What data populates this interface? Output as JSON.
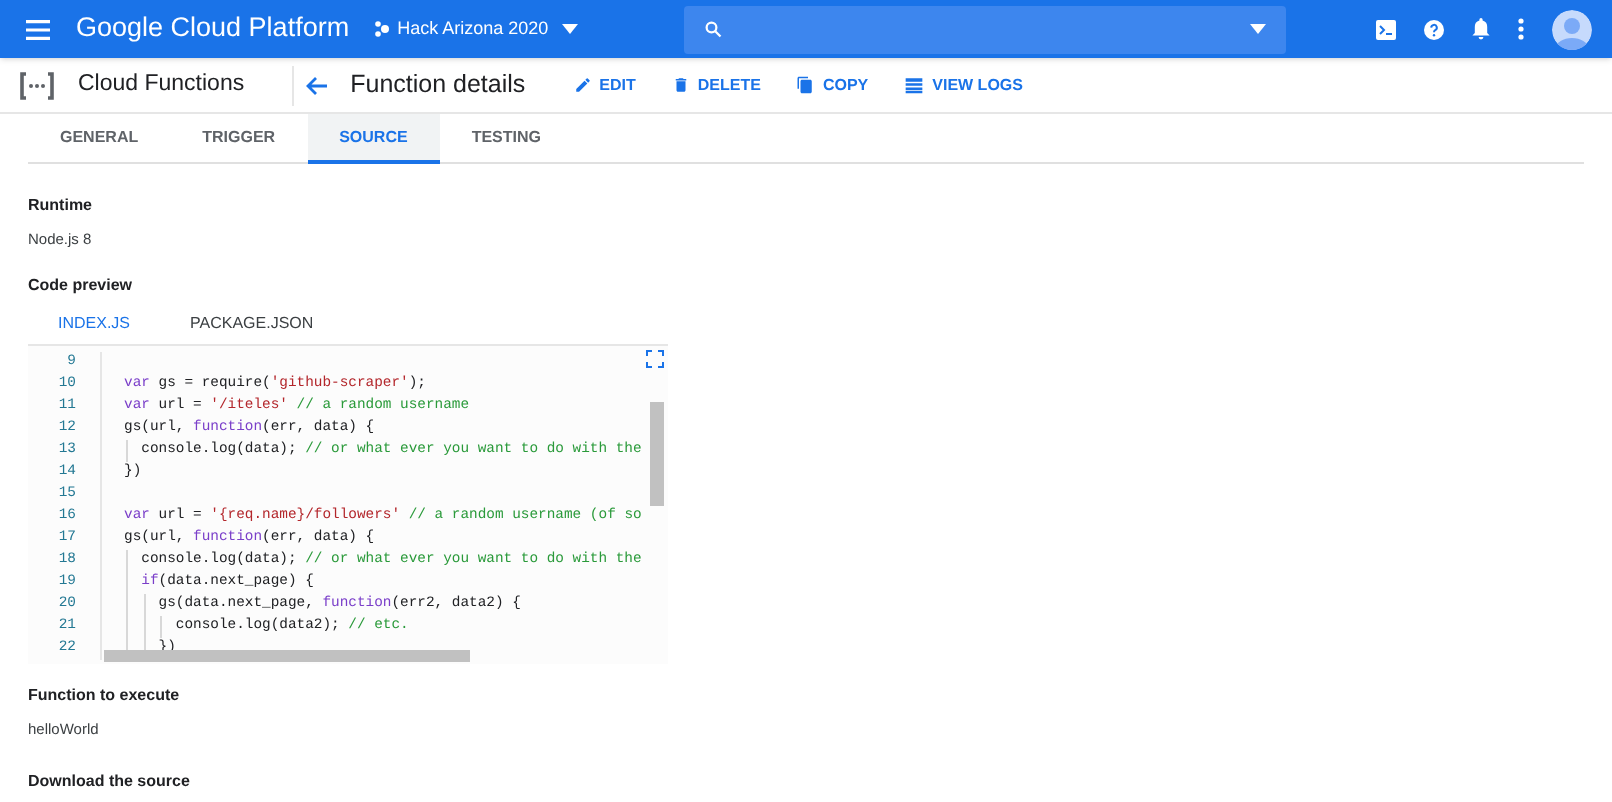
{
  "app_bar": {
    "title": "Google Cloud Platform",
    "project": "Hack Arizona 2020"
  },
  "header": {
    "product": "Cloud Functions",
    "page_title": "Function details",
    "actions": [
      {
        "kind": "edit",
        "label": "EDIT"
      },
      {
        "kind": "delete",
        "label": "DELETE"
      },
      {
        "kind": "copy",
        "label": "COPY"
      },
      {
        "kind": "logs",
        "label": "VIEW LOGS"
      }
    ]
  },
  "tabs": [
    {
      "label": "GENERAL",
      "selected": false
    },
    {
      "label": "TRIGGER",
      "selected": false
    },
    {
      "label": "SOURCE",
      "selected": true
    },
    {
      "label": "TESTING",
      "selected": false
    }
  ],
  "runtime": {
    "label": "Runtime",
    "value": "Node.js 8"
  },
  "code_preview": {
    "label": "Code preview",
    "file_tabs": [
      {
        "label": "INDEX.JS",
        "selected": true
      },
      {
        "label": "PACKAGE.JSON",
        "selected": false
      }
    ],
    "lines": [
      {
        "number": "9"
      },
      {
        "number": "10",
        "tokens": [
          {
            "kind": "kw",
            "text": "var"
          },
          {
            "kind": "plain",
            "text": " gs = require("
          },
          {
            "kind": "str",
            "text": "'github-scraper'"
          },
          {
            "kind": "plain",
            "text": ");"
          }
        ]
      },
      {
        "number": "11",
        "tokens": [
          {
            "kind": "kw",
            "text": "var"
          },
          {
            "kind": "plain",
            "text": " url = "
          },
          {
            "kind": "str",
            "text": "'/iteles'"
          },
          {
            "kind": "cm",
            "text": " // a random username"
          }
        ]
      },
      {
        "number": "12",
        "tokens": [
          {
            "kind": "plain",
            "text": "gs(url, "
          },
          {
            "kind": "kw",
            "text": "function"
          },
          {
            "kind": "plain",
            "text": "(err, data) {"
          }
        ]
      },
      {
        "number": "13",
        "tokens": [
          {
            "kind": "plain",
            "text": "  console.log(data);"
          },
          {
            "kind": "cm",
            "text": " // or what ever you want to do with the"
          }
        ]
      },
      {
        "number": "14",
        "tokens": [
          {
            "kind": "plain",
            "text": "})"
          }
        ]
      },
      {
        "number": "15"
      },
      {
        "number": "16",
        "tokens": [
          {
            "kind": "kw",
            "text": "var"
          },
          {
            "kind": "plain",
            "text": " url = "
          },
          {
            "kind": "str",
            "text": "'{req.name}/followers'"
          },
          {
            "kind": "cm",
            "text": " // a random username (of so"
          }
        ]
      },
      {
        "number": "17",
        "tokens": [
          {
            "kind": "plain",
            "text": "gs(url, "
          },
          {
            "kind": "kw",
            "text": "function"
          },
          {
            "kind": "plain",
            "text": "(err, data) {"
          }
        ]
      },
      {
        "number": "18",
        "tokens": [
          {
            "kind": "plain",
            "text": "  console.log(data);"
          },
          {
            "kind": "cm",
            "text": " // or what ever you want to do with the"
          }
        ]
      },
      {
        "number": "19",
        "tokens": [
          {
            "kind": "kw",
            "text": "  if"
          },
          {
            "kind": "plain",
            "text": "(data.next_page) {"
          }
        ]
      },
      {
        "number": "20",
        "tokens": [
          {
            "kind": "plain",
            "text": "    gs(data.next_page, "
          },
          {
            "kind": "kw",
            "text": "function"
          },
          {
            "kind": "plain",
            "text": "(err2, data2) {"
          }
        ]
      },
      {
        "number": "21",
        "tokens": [
          {
            "kind": "plain",
            "text": "      console.log(data2);"
          },
          {
            "kind": "cm",
            "text": " // etc."
          }
        ]
      },
      {
        "number": "22",
        "tokens": [
          {
            "kind": "plain",
            "text": "    })"
          }
        ]
      }
    ]
  },
  "entry_point": {
    "label": "Function to execute",
    "value": "helloWorld"
  },
  "download": {
    "label": "Download the source"
  }
}
